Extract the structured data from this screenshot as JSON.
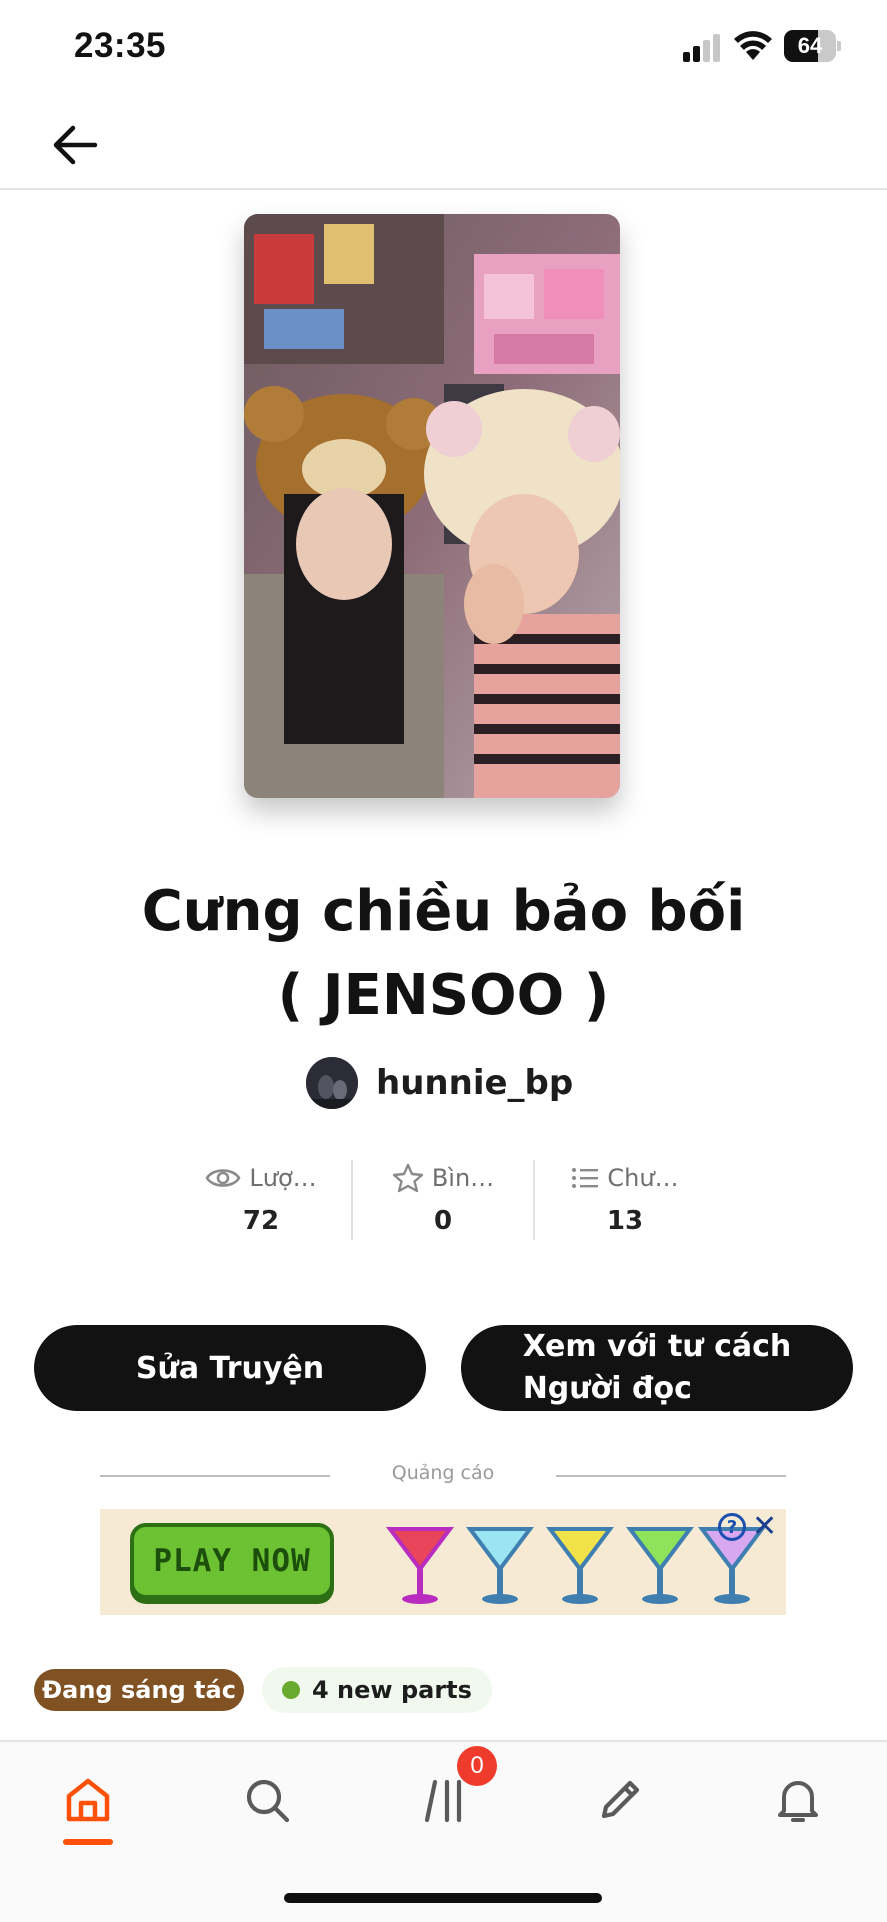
{
  "status_bar": {
    "time": "23:35",
    "battery": "64"
  },
  "story": {
    "title_line1": "Cưng chiều bảo bối",
    "title_line2": "( JENSOO )",
    "author": "hunnie_bp"
  },
  "stats": [
    {
      "label": "Lượ…",
      "value": "72",
      "icon": "eye-icon"
    },
    {
      "label": "Bìn…",
      "value": "0",
      "icon": "star-icon"
    },
    {
      "label": "Chư…",
      "value": "13",
      "icon": "list-icon"
    }
  ],
  "actions": {
    "edit_label": "Sửa Truyện",
    "read_label_line1": "Xem với tư cách",
    "read_label_line2": "Người đọc"
  },
  "ad": {
    "label": "Quảng cáo",
    "cta": "PLAY NOW",
    "info": "?",
    "close": "✕"
  },
  "tags": {
    "status": "Đang sáng tác",
    "new_parts": "4 new parts"
  },
  "bottom_nav": {
    "items": [
      "home-icon",
      "search-icon",
      "library-icon",
      "write-icon",
      "bell-icon"
    ],
    "library_badge": "0",
    "active": "home",
    "accent_color": "#ff500a"
  }
}
